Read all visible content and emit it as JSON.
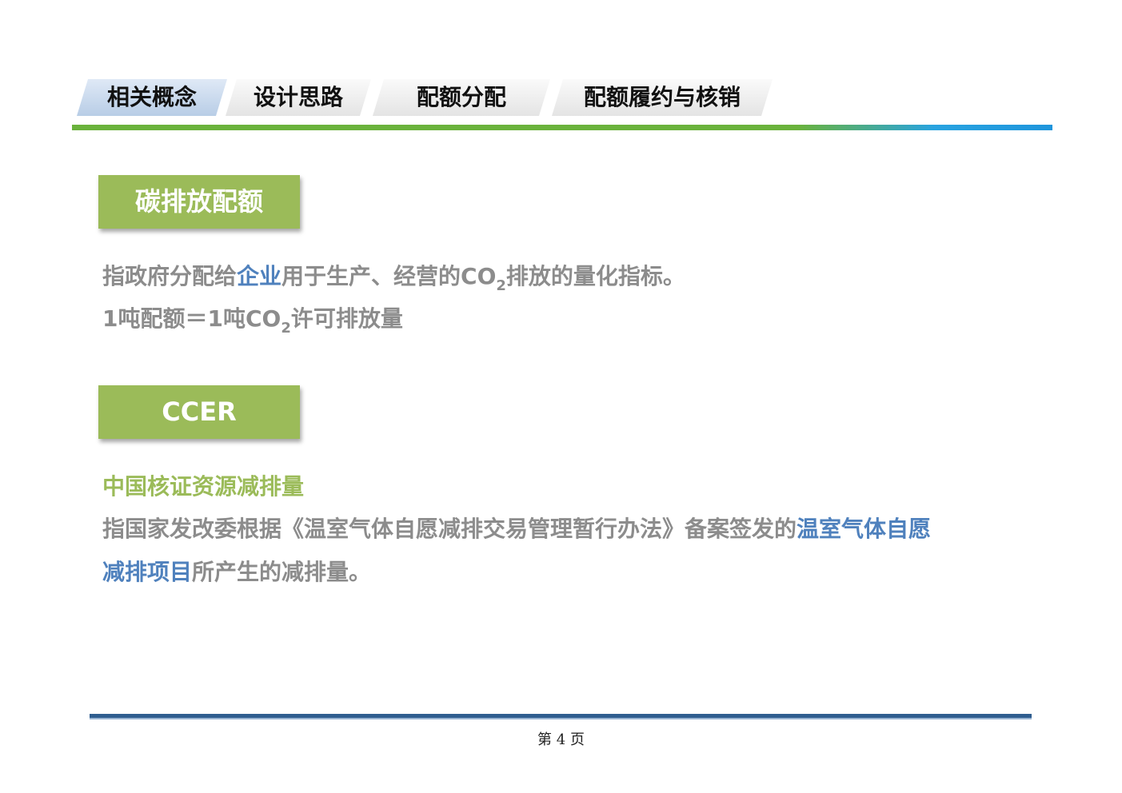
{
  "nav": {
    "tabs": [
      {
        "label": "相关概念",
        "active": true
      },
      {
        "label": "设计思路",
        "active": false
      },
      {
        "label": "配额分配",
        "active": false
      },
      {
        "label": "配额履约与核销",
        "active": false
      }
    ]
  },
  "section1": {
    "heading": "碳排放配额",
    "line1": {
      "pre": "指政府分配给",
      "highlight": "企业",
      "mid": "用于生产、经营的CO",
      "sub": "2",
      "post": "排放的量化指标。"
    },
    "line2": {
      "pre": "1吨配额＝1吨CO",
      "sub": "2",
      "post": "许可排放量"
    }
  },
  "section2": {
    "heading": "CCER",
    "subtitle": "中国核证资源减排量",
    "line1": {
      "pre": "指国家发改委根据《温室气体自愿减排交易管理暂行办法》备案签发的",
      "highlight": "温室气体自愿"
    },
    "line2": {
      "highlight": "减排项目",
      "post": "所产生的减排量。"
    }
  },
  "footer": {
    "page": "第 4 页"
  },
  "colors": {
    "green": "#9bbb59",
    "blue": "#4f81bd",
    "gray_text": "#8c8c8c",
    "tab_active": "#b8cde6"
  }
}
